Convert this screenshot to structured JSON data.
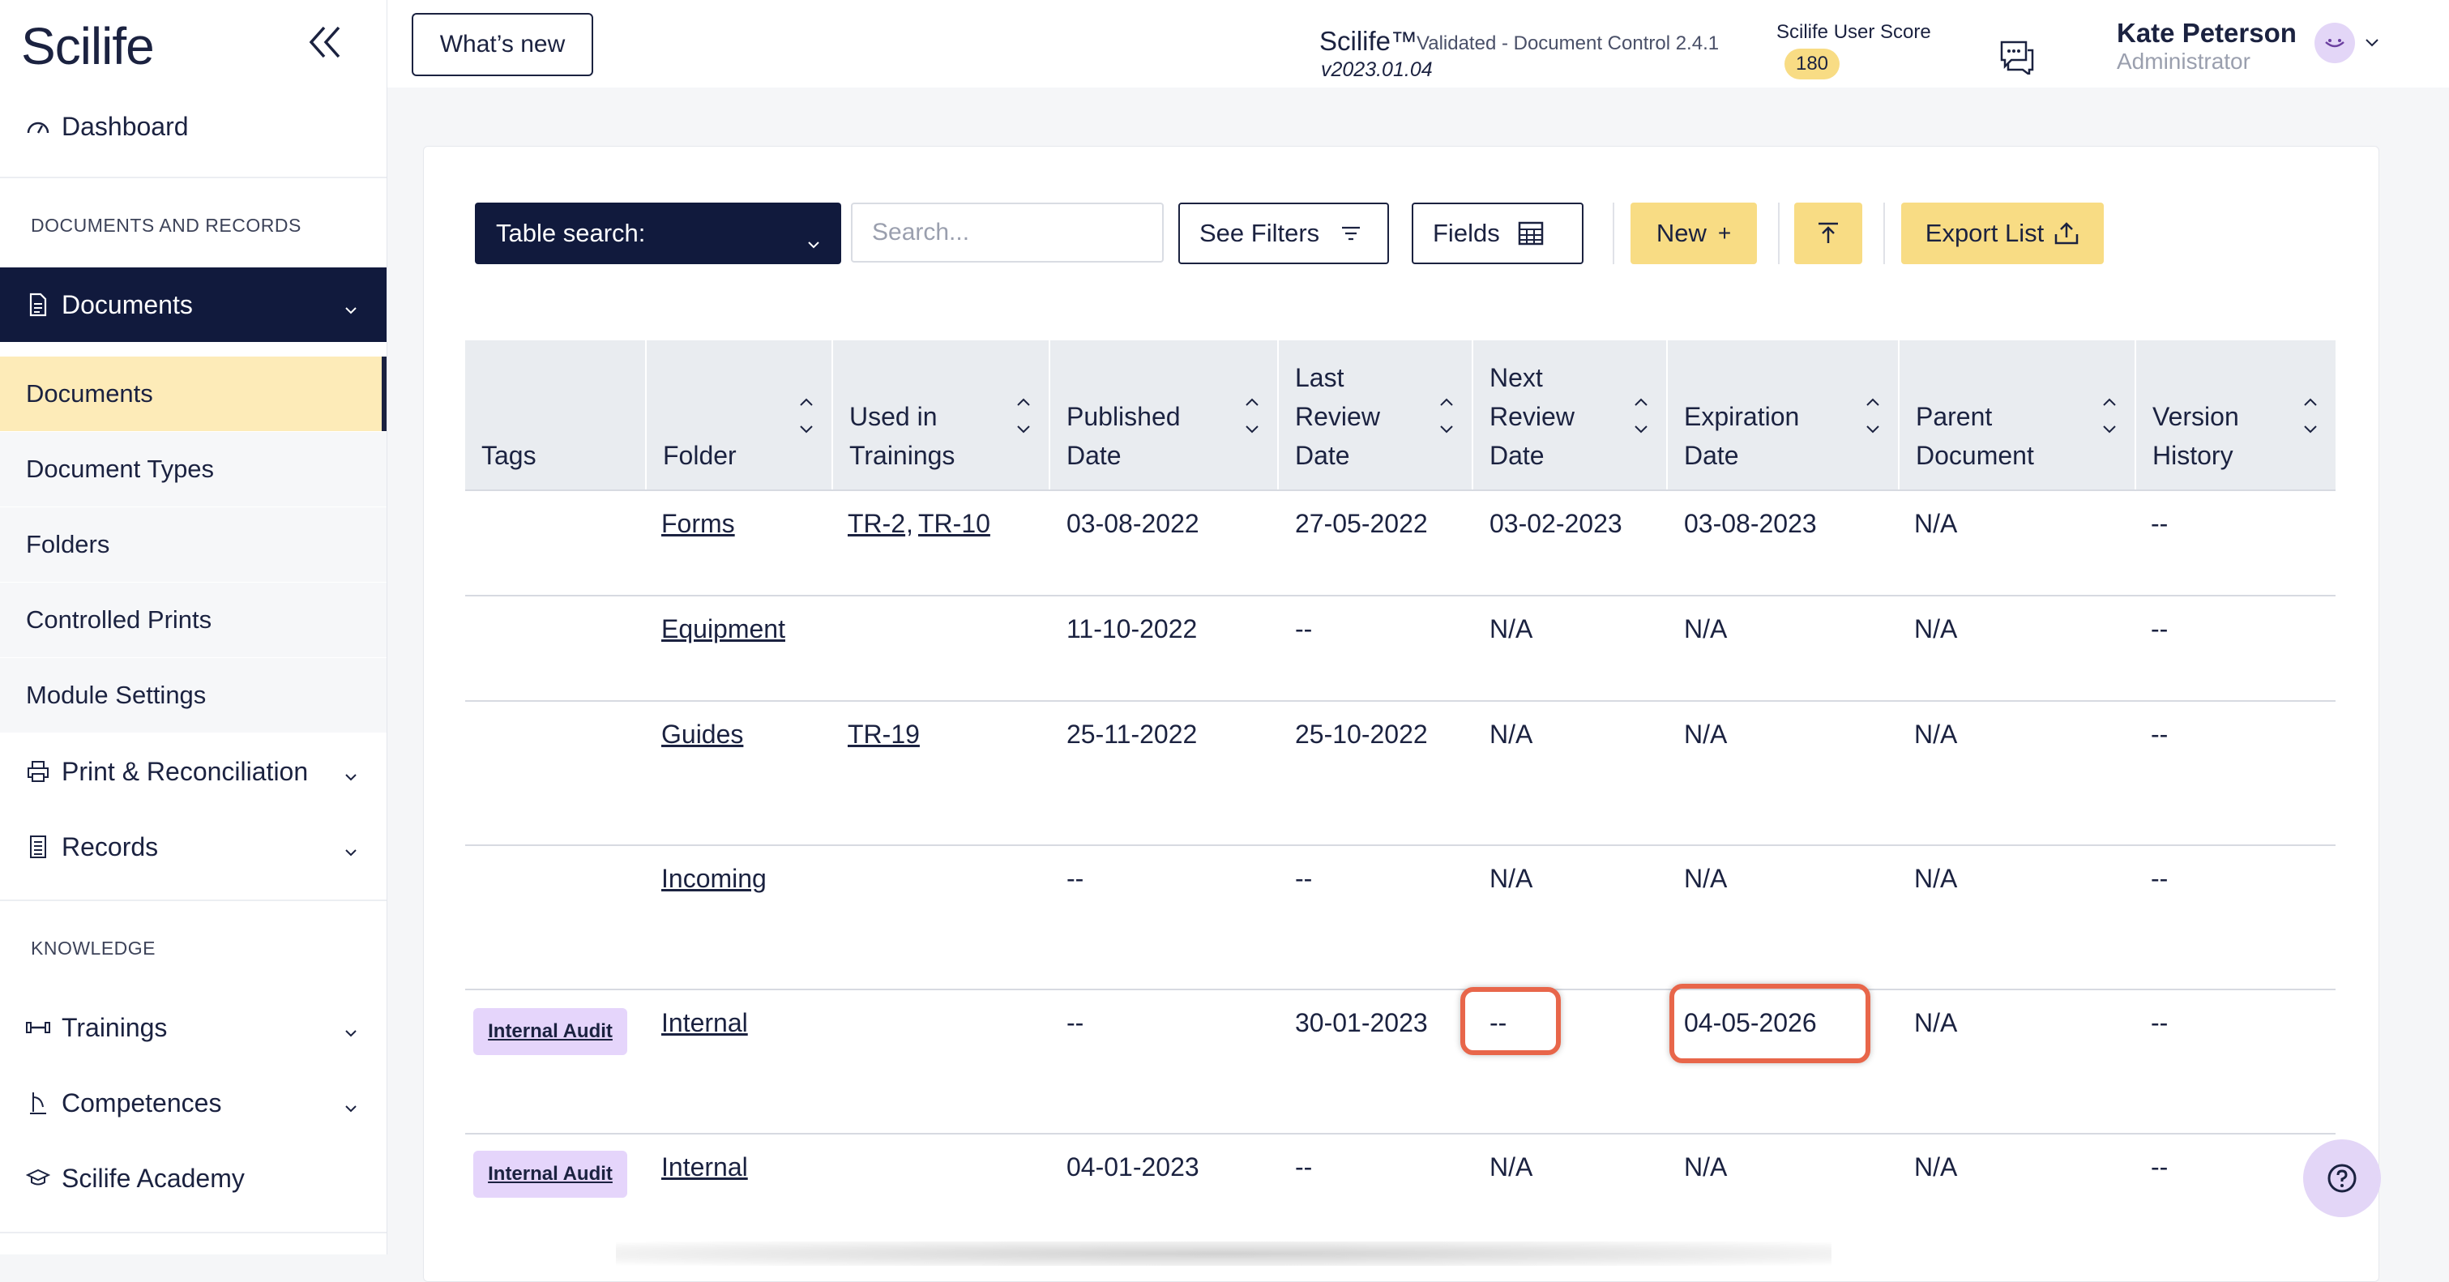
{
  "sidebar": {
    "logo": "Scilife",
    "dashboard": "Dashboard",
    "section_docs": "DOCUMENTS AND RECORDS",
    "documents_group": "Documents",
    "sub_items": [
      "Documents",
      "Document Types",
      "Folders",
      "Controlled Prints",
      "Module Settings"
    ],
    "print_recon": "Print & Reconciliation",
    "records": "Records",
    "section_knowledge": "KNOWLEDGE",
    "trainings": "Trainings",
    "competences": "Competences",
    "academy": "Scilife Academy"
  },
  "header": {
    "whats_new": "What’s new",
    "app_title": "Scilife™",
    "app_sub": "Validated - Document Control 2.4.1",
    "app_version": "v2023.01.04",
    "score_label": "Scilife User Score",
    "score_value": "180",
    "user_name": "Kate Peterson",
    "user_role": "Administrator"
  },
  "toolbar": {
    "table_search": "Table search:",
    "search_placeholder": "Search...",
    "see_filters": "See Filters",
    "fields": "Fields",
    "new": "New",
    "new_icon": "+",
    "export": "Export List"
  },
  "table": {
    "headers": [
      "Tags",
      "Folder",
      "Used in Trainings",
      "Published Date",
      "Last Review Date",
      "Next Review Date",
      "Expiration Date",
      "Parent Document",
      "Version History"
    ],
    "rows": [
      {
        "tag": "",
        "folder": "Forms",
        "trainings": [
          "TR-2",
          "TR-10"
        ],
        "published": "03-08-2022",
        "last_review": "27-05-2022",
        "next_review": "03-02-2023",
        "expiration": "03-08-2023",
        "parent": "N/A",
        "version": "--"
      },
      {
        "tag": "",
        "folder": "Equipment",
        "trainings": [],
        "published": "11-10-2022",
        "last_review": "--",
        "next_review": "N/A",
        "expiration": "N/A",
        "parent": "N/A",
        "version": "--"
      },
      {
        "tag": "",
        "folder": "Guides",
        "trainings": [
          "TR-19"
        ],
        "published": "25-11-2022",
        "last_review": "25-10-2022",
        "next_review": "N/A",
        "expiration": "N/A",
        "parent": "N/A",
        "version": "--"
      },
      {
        "tag": "",
        "folder": "Incoming",
        "trainings": [],
        "published": "--",
        "last_review": "--",
        "next_review": "N/A",
        "expiration": "N/A",
        "parent": "N/A",
        "version": "--"
      },
      {
        "tag": "Internal Audit",
        "folder": "Internal",
        "trainings": [],
        "published": "--",
        "last_review": "30-01-2023",
        "next_review": "--",
        "expiration": "04-05-2026",
        "parent": "N/A",
        "version": "--"
      },
      {
        "tag": "Internal Audit",
        "folder": "Internal",
        "trainings": [],
        "published": "04-01-2023",
        "last_review": "--",
        "next_review": "N/A",
        "expiration": "N/A",
        "parent": "N/A",
        "version": "--"
      }
    ]
  },
  "colors": {
    "navy": "#111a3d",
    "accent_yellow": "#f8dc84",
    "active_bg": "#fdebb8",
    "tag_purple": "#e5d5fb",
    "highlight": "#e8664a"
  }
}
